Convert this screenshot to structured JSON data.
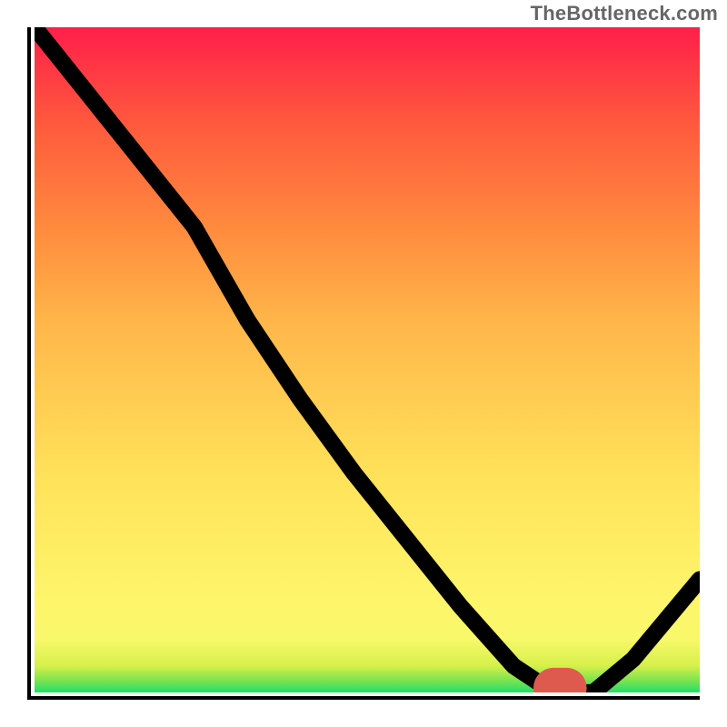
{
  "watermark": "TheBottleneck.com",
  "colors": {
    "curve": "#000000",
    "vertex_marker": "#de5a4f",
    "frame": "#000000"
  },
  "chart_data": {
    "type": "line",
    "title": "",
    "xlabel": "",
    "ylabel": "",
    "xlim": [
      0,
      100
    ],
    "ylim": [
      0,
      100
    ],
    "grid": false,
    "series": [
      {
        "name": "curve",
        "x": [
          0,
          8,
          16,
          24,
          32,
          40,
          48,
          56,
          64,
          72,
          78,
          84,
          90,
          100
        ],
        "y": [
          100,
          90,
          80,
          70,
          56,
          44,
          33,
          23,
          13,
          4,
          0,
          0,
          5,
          17
        ]
      }
    ],
    "annotations": [
      {
        "name": "vertex-marker",
        "x_range": [
          78,
          87
        ],
        "y": 0
      }
    ]
  }
}
